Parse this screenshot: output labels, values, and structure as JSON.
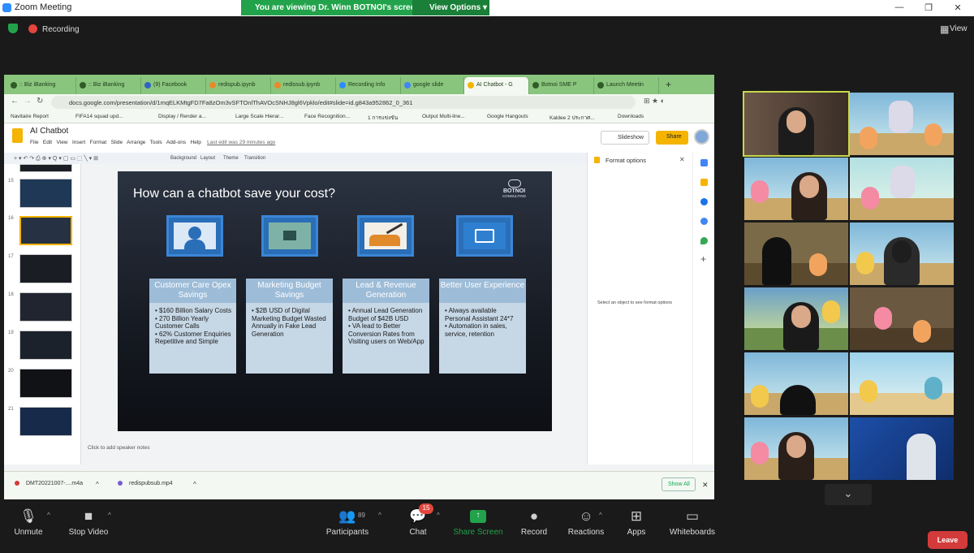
{
  "zoom": {
    "title": "Zoom Meeting",
    "share_banner": "You are viewing Dr. Winn BOTNOI's screen",
    "view_options": "View Options",
    "recording": "Recording",
    "view": "View"
  },
  "browser": {
    "tabs": [
      ":: Biz iBanking",
      ":: Biz iBanking",
      "(9) Facebook",
      "redispub.ipynb",
      "redissub.ipynb",
      "Recording Info",
      "google slide",
      "AI Chatbot - G",
      "Botnoi SME P",
      "Launch Meetin"
    ],
    "url": "docs.google.com/presentation/d/1mqELKMtgFD7Fa8zOm3vSFTOnlThAVOcSNHJ8gl6Vpklo/edit#slide=id.g843a952862_0_361",
    "bookmarks": [
      "Navitaire Report",
      "FIFA14 squad upd...",
      "Display / Render a...",
      "Large Scale Hierar...",
      "Face Recognition...",
      "1 การแข่งขัน",
      "Output Multi-line...",
      "Google Hangouts",
      "Kaldee 2 ประกาศ...",
      "Downloads"
    ]
  },
  "docs": {
    "title": "AI Chatbot",
    "menu": [
      "File",
      "Edit",
      "View",
      "Insert",
      "Format",
      "Slide",
      "Arrange",
      "Tools",
      "Add-ons",
      "Help"
    ],
    "last_edit": "Last edit was 29 minutes ago",
    "slideshow": "Slideshow",
    "share": "Share",
    "toolbar": [
      "Background",
      "Layout",
      "Theme",
      "Transition"
    ],
    "thumb_numbers": [
      "15",
      "16",
      "17",
      "18",
      "19",
      "20",
      "21"
    ],
    "notes": "Click to add speaker notes",
    "format_title": "Format options",
    "format_hint": "Select an object to see format options"
  },
  "slide": {
    "title": "How can a chatbot save your cost?",
    "logo": "BOTNOI",
    "logo_sub": "CONSULTING",
    "cards": [
      {
        "title": "Customer Care Opex Savings",
        "bullets": [
          "$160 Billion Salary Costs",
          "270 Billion Yearly Customer Calls",
          "62% Customer Enquiries Repetitive and Simple"
        ]
      },
      {
        "title": "Marketing Budget Savings",
        "bullets": [
          "$2B USD of Digital Marketing Budget Wasted Annually in Fake Lead Generation"
        ]
      },
      {
        "title": "Lead & Revenue Generation",
        "bullets": [
          "Annual Lead Generation Budget of $42B USD",
          "VA lead to Better Conversion Rates from Visiting users on Web/App"
        ]
      },
      {
        "title": "Better User Experience",
        "bullets": [
          "Always available Personal Assistant 24*7",
          "Automation in sales, service, retention"
        ]
      }
    ]
  },
  "downloads": {
    "items": [
      "DMT20221007-....m4a",
      "redispubsub.mp4"
    ],
    "show_all": "Show All"
  },
  "controls": {
    "unmute": "Unmute",
    "stop_video": "Stop Video",
    "participants": "Participants",
    "participants_count": "89",
    "chat": "Chat",
    "chat_badge": "15",
    "share_screen": "Share Screen",
    "record": "Record",
    "reactions": "Reactions",
    "apps": "Apps",
    "whiteboards": "Whiteboards",
    "leave": "Leave"
  },
  "colors": {
    "zoom_green": "#22a34b",
    "tab_green": "#8ac57e",
    "leave_red": "#d33b3b",
    "slide_card": "#c6d7e6",
    "active_speaker": "#c6d84c"
  }
}
